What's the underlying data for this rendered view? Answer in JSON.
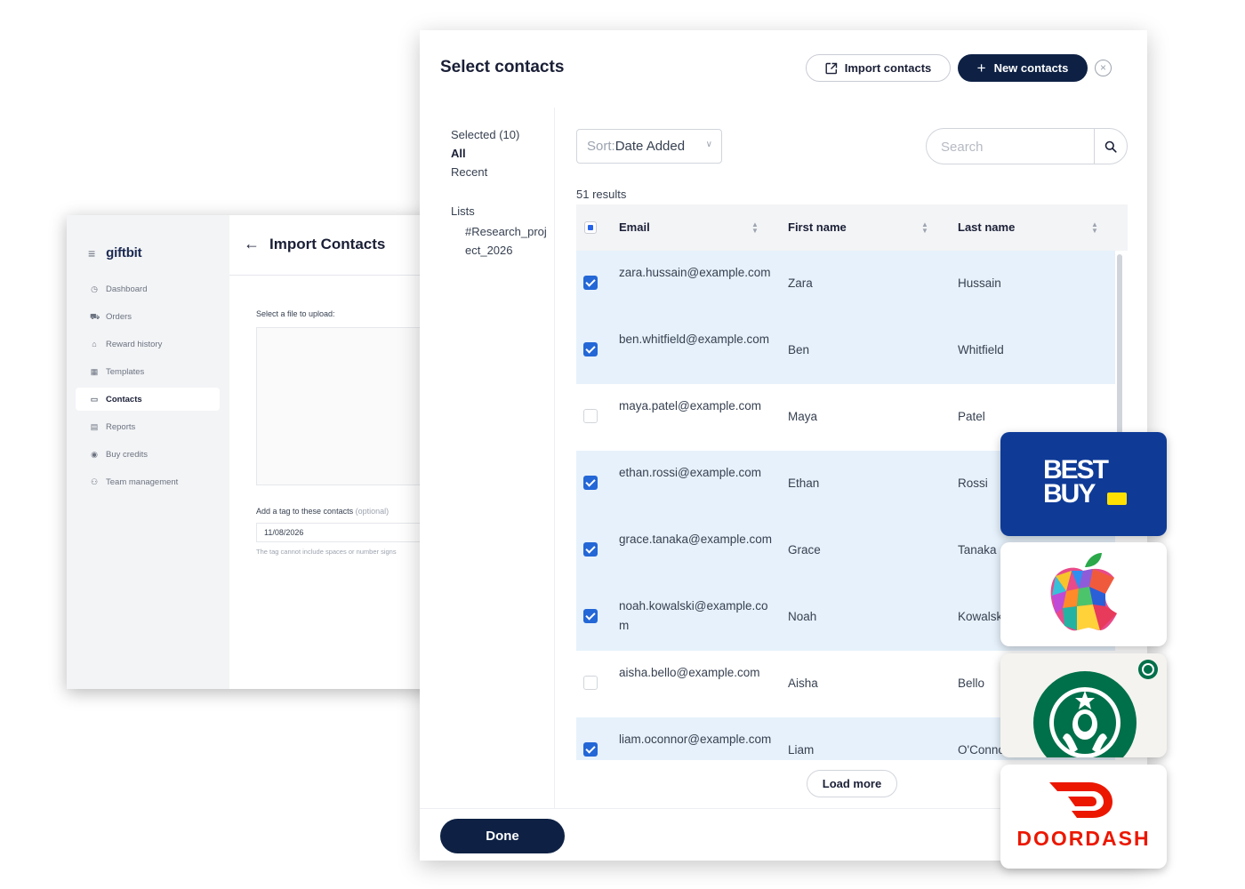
{
  "background_app": {
    "logo": "giftbit",
    "nav": [
      {
        "label": "Dashboard",
        "icon": "dashboard-icon",
        "glyph": "◷"
      },
      {
        "label": "Orders",
        "icon": "cart-icon",
        "glyph": "⛟"
      },
      {
        "label": "Reward history",
        "icon": "gift-icon",
        "glyph": "⌂"
      },
      {
        "label": "Templates",
        "icon": "grid-icon",
        "glyph": "▦"
      },
      {
        "label": "Contacts",
        "icon": "contact-card-icon",
        "glyph": "▭",
        "active": true
      },
      {
        "label": "Reports",
        "icon": "report-icon",
        "glyph": "▤"
      },
      {
        "label": "Buy credits",
        "icon": "coin-icon",
        "glyph": "◉"
      },
      {
        "label": "Team management",
        "icon": "team-icon",
        "glyph": "⚇"
      }
    ],
    "title": "Import Contacts",
    "upload_label": "Select a file to upload:",
    "tag_label": "Add a tag to these contacts",
    "tag_optional": "(optional)",
    "tag_value": "11/08/2026",
    "tag_help": "The tag cannot include spaces or number signs"
  },
  "modal": {
    "title": "Select contacts",
    "import_label": "Import contacts",
    "new_label": "New contacts",
    "sidebar": {
      "selected": "Selected (10)",
      "all": "All",
      "recent": "Recent",
      "lists_heading": "Lists",
      "list_item": "#Research_project_2026"
    },
    "sort_prefix": "Sort:",
    "sort_value": "Date Added",
    "search_placeholder": "Search",
    "results": "51 results",
    "columns": {
      "email": "Email",
      "first": "First name",
      "last": "Last name"
    },
    "rows": [
      {
        "email": "zara.hussain@example.com",
        "first": "Zara",
        "last": "Hussain",
        "selected": true
      },
      {
        "email": "ben.whitfield@example.com",
        "first": "Ben",
        "last": "Whitfield",
        "selected": true
      },
      {
        "email": "maya.patel@example.com",
        "first": "Maya",
        "last": "Patel",
        "selected": false
      },
      {
        "email": "ethan.rossi@example.com",
        "first": "Ethan",
        "last": "Rossi",
        "selected": true
      },
      {
        "email": "grace.tanaka@example.com",
        "first": "Grace",
        "last": "Tanaka",
        "selected": true
      },
      {
        "email": "noah.kowalski@example.com",
        "first": "Noah",
        "last": "Kowalski",
        "selected": true
      },
      {
        "email": "aisha.bello@example.com",
        "first": "Aisha",
        "last": "Bello",
        "selected": false
      },
      {
        "email": "liam.oconnor@example.com",
        "first": "Liam",
        "last": "O'Connor",
        "selected": true
      }
    ],
    "load_more": "Load more",
    "done": "Done"
  },
  "gift_cards": [
    {
      "brand": "BEST BUY",
      "line1": "BEST",
      "line2": "BUY",
      "color": "#0f3b97"
    },
    {
      "brand": "Apple",
      "color": "#ffffff"
    },
    {
      "brand": "Starbucks",
      "color": "#00704a"
    },
    {
      "brand": "DOORDASH",
      "color": "#eb1700"
    }
  ]
}
